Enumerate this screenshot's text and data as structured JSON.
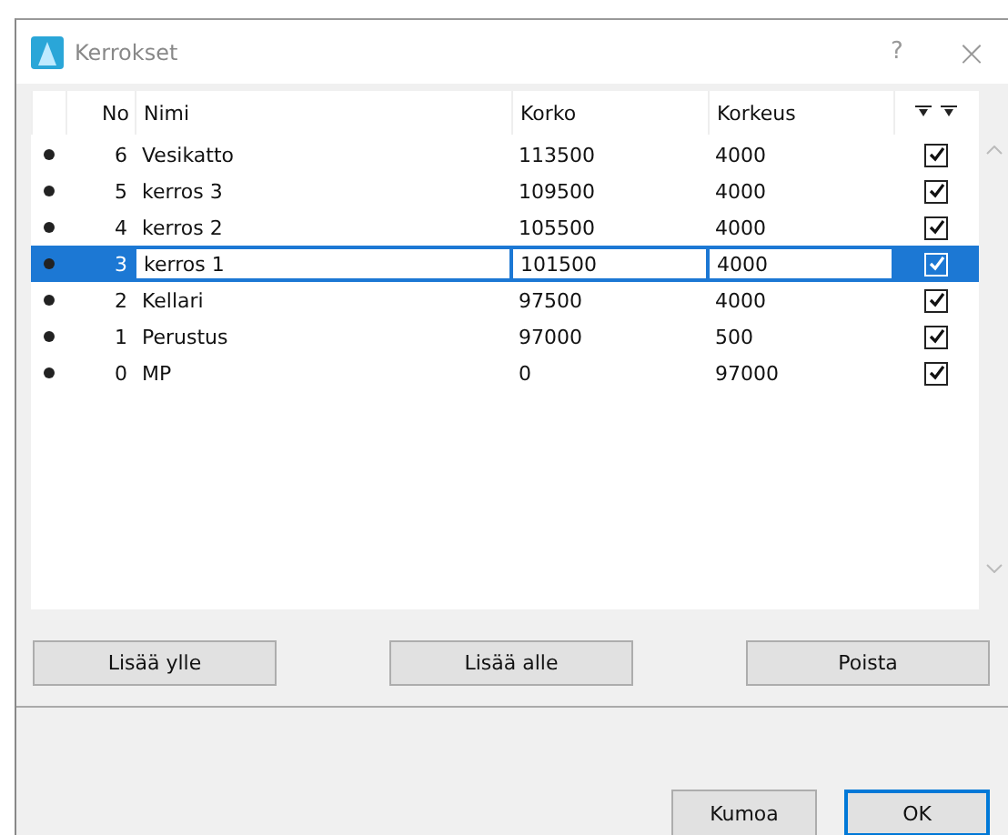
{
  "window": {
    "title": "Kerrokset",
    "help": "?",
    "close": "×"
  },
  "table": {
    "columns": [
      "No",
      "Nimi",
      "Korko",
      "Korkeus"
    ],
    "rows": [
      {
        "no": "6",
        "name": "Vesikatto",
        "korko": "113500",
        "korkeus": "4000",
        "checked": true,
        "selected": false
      },
      {
        "no": "5",
        "name": "kerros 3",
        "korko": "109500",
        "korkeus": "4000",
        "checked": true,
        "selected": false
      },
      {
        "no": "4",
        "name": "kerros 2",
        "korko": "105500",
        "korkeus": "4000",
        "checked": true,
        "selected": false
      },
      {
        "no": "3",
        "name": "kerros 1",
        "korko": "101500",
        "korkeus": "4000",
        "checked": true,
        "selected": true
      },
      {
        "no": "2",
        "name": "Kellari",
        "korko": "97500",
        "korkeus": "4000",
        "checked": true,
        "selected": false
      },
      {
        "no": "1",
        "name": "Perustus",
        "korko": "97000",
        "korkeus": "500",
        "checked": true,
        "selected": false
      },
      {
        "no": "0",
        "name": "MP",
        "korko": "0",
        "korkeus": "97000",
        "checked": true,
        "selected": false
      }
    ]
  },
  "actions": [
    "Lisää ylle",
    "Lisää alle",
    "Poista"
  ],
  "footer_buttons": [
    {
      "label": "Kumoa",
      "default": false
    },
    {
      "label": "OK",
      "default": true
    }
  ]
}
